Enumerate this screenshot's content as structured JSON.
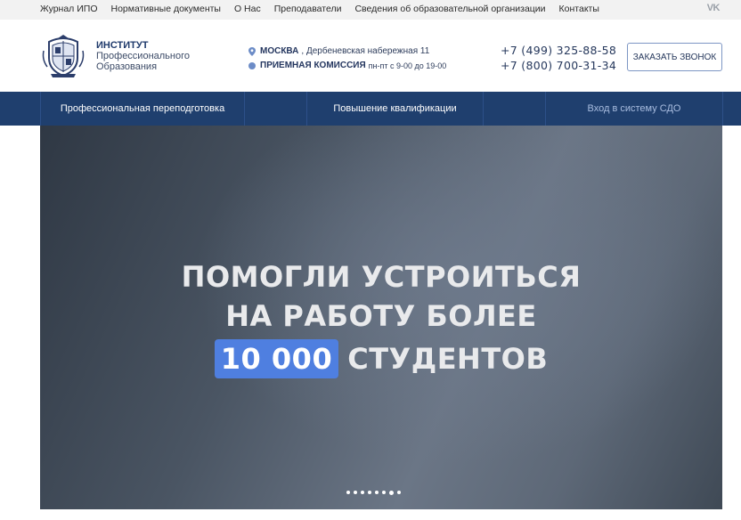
{
  "topbar": {
    "links": [
      "Журнал ИПО",
      "Нормативные документы",
      "О Нас",
      "Преподаватели",
      "Сведения об образовательной организации",
      "Контакты"
    ],
    "social": "VK"
  },
  "brand": {
    "line1": "ИНСТИТУТ",
    "line2": "Профессионального",
    "line3": "Образования"
  },
  "address": {
    "city": "МОСКВА",
    "street": ", Дербеневская набережная 11",
    "office": "ПРИЕМНАЯ КОМИССИЯ",
    "hours": "пн-пт с 9-00 до 19-00"
  },
  "phones": [
    "+7 (499) 325-88-58",
    "+7 (800) 700-31-34"
  ],
  "callback": "ЗАКАЗАТЬ ЗВОНОК",
  "nav": {
    "items": [
      "Профессиональная переподготовка",
      "Повышение квалификации",
      "Вход в систему СДО"
    ]
  },
  "hero": {
    "line1": "ПОМОГЛИ УСТРОИТЬСЯ",
    "line2": "НА РАБОТУ БОЛЕЕ",
    "number": "10 000",
    "line3": "СТУДЕНТОВ",
    "slides_count": 8,
    "active_slide": 7
  },
  "colors": {
    "nav_bg": "#1f3f6e",
    "badge": "#4f7fe0",
    "topbar_bg": "#f2f2f2"
  }
}
